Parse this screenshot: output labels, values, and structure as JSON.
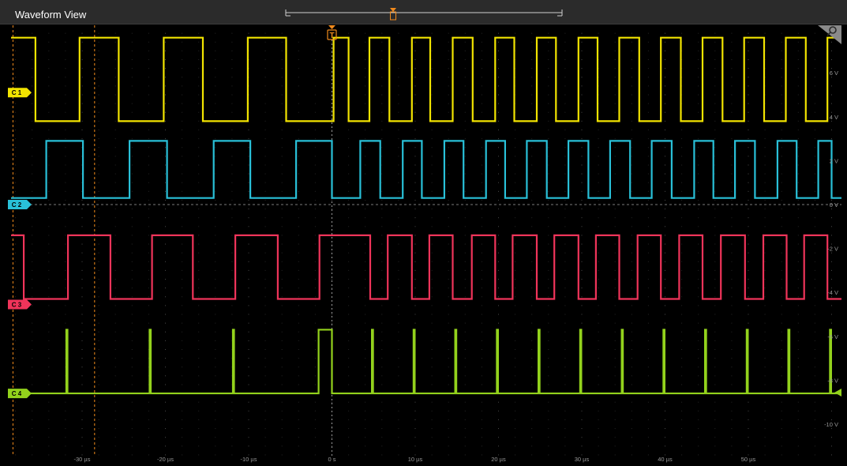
{
  "window": {
    "title": "Waveform View"
  },
  "colors": {
    "background": "#000000",
    "grid": "#3c3c3c",
    "trigger": "#f08a1c",
    "C1": "#f2e400",
    "C2": "#29c0d8",
    "C3": "#f0345a",
    "C4": "#93d21c"
  },
  "icons": {
    "trigger_marker": "trigger-t-icon",
    "zoom_corner": "magnifier-icon"
  },
  "trigger_label": "T",
  "channels": [
    {
      "id": "C1",
      "label": "C 1",
      "color": "#f2e400"
    },
    {
      "id": "C2",
      "label": "C 2",
      "color": "#29c0d8"
    },
    {
      "id": "C3",
      "label": "C 3",
      "color": "#f0345a"
    },
    {
      "id": "C4",
      "label": "C 4",
      "color": "#93d21c"
    }
  ],
  "x_axis": {
    "labels": [
      "-30 µs",
      "-20 µs",
      "-10 µs",
      "0 s",
      "10 µs",
      "20 µs",
      "30 µs",
      "40 µs",
      "50 µs"
    ],
    "values_us": [
      -30,
      -20,
      -10,
      0,
      10,
      20,
      30,
      40,
      50
    ]
  },
  "y_axis": {
    "labels": [
      "6 V",
      "4 V",
      "2 V",
      "0 V",
      "-2 V",
      "-4 V",
      "-6 V",
      "-8 V",
      "-10 V"
    ],
    "values_v": [
      6,
      4,
      2,
      0,
      -2,
      -4,
      -6,
      -8,
      -10
    ]
  },
  "chart_data": {
    "type": "line",
    "x_unit": "µs",
    "y_unit": "V",
    "xlim": [
      -38.5,
      60
    ],
    "ylim": [
      -12,
      10
    ],
    "series": [
      {
        "name": "C 1",
        "high_v": 7.6,
        "low_v": 3.8,
        "edges_us": [
          -35.6,
          -30.3,
          -25.6,
          -20.2,
          -15.5,
          -10.1,
          -5.5,
          0.2,
          2.0,
          4.5,
          6.9,
          9.6,
          11.8,
          14.5,
          16.9,
          19.6,
          21.9,
          24.6,
          26.9,
          29.6,
          31.9,
          34.5,
          36.9,
          39.5,
          41.9,
          44.5,
          46.9,
          49.5,
          51.9,
          54.5,
          56.9,
          59.5
        ],
        "start_state": "high"
      },
      {
        "name": "C 2",
        "high_v": 2.9,
        "low_v": 0.3,
        "edges_us": [
          -34.3,
          -29.9,
          -24.3,
          -19.8,
          -14.2,
          -9.8,
          -4.3,
          0.0,
          3.4,
          5.8,
          8.5,
          10.8,
          13.5,
          15.8,
          18.5,
          20.8,
          23.4,
          25.8,
          28.4,
          30.8,
          33.4,
          35.8,
          38.4,
          40.8,
          43.5,
          45.8,
          48.4,
          50.8,
          53.5,
          55.8,
          58.4,
          60.0
        ],
        "start_state": "low"
      },
      {
        "name": "C 3",
        "high_v": -1.4,
        "low_v": -4.3,
        "edges_us": [
          -37.0,
          -31.7,
          -26.6,
          -21.6,
          -16.7,
          -11.6,
          -6.5,
          -1.5,
          4.6,
          6.7,
          9.6,
          11.7,
          14.5,
          16.8,
          19.6,
          21.7,
          24.6,
          26.7,
          29.6,
          31.7,
          34.5,
          36.7,
          39.5,
          41.7,
          44.5,
          46.7,
          49.6,
          51.8,
          54.6,
          56.7,
          59.5
        ],
        "start_state": "high"
      },
      {
        "name": "C 4",
        "base_v": -8.6,
        "pulse_v": -5.7,
        "pulses_us": [
          -31.9,
          -21.9,
          -11.9,
          4.8,
          9.8,
          14.8,
          19.8,
          24.8,
          29.8,
          34.8,
          39.8,
          44.8,
          49.8,
          54.8,
          59.8
        ],
        "plateau_us": [
          -1.6,
          0.0
        ]
      }
    ],
    "cursors_us": [
      -38.3,
      -28.5
    ],
    "trigger_us": 0.0,
    "grid": true
  }
}
